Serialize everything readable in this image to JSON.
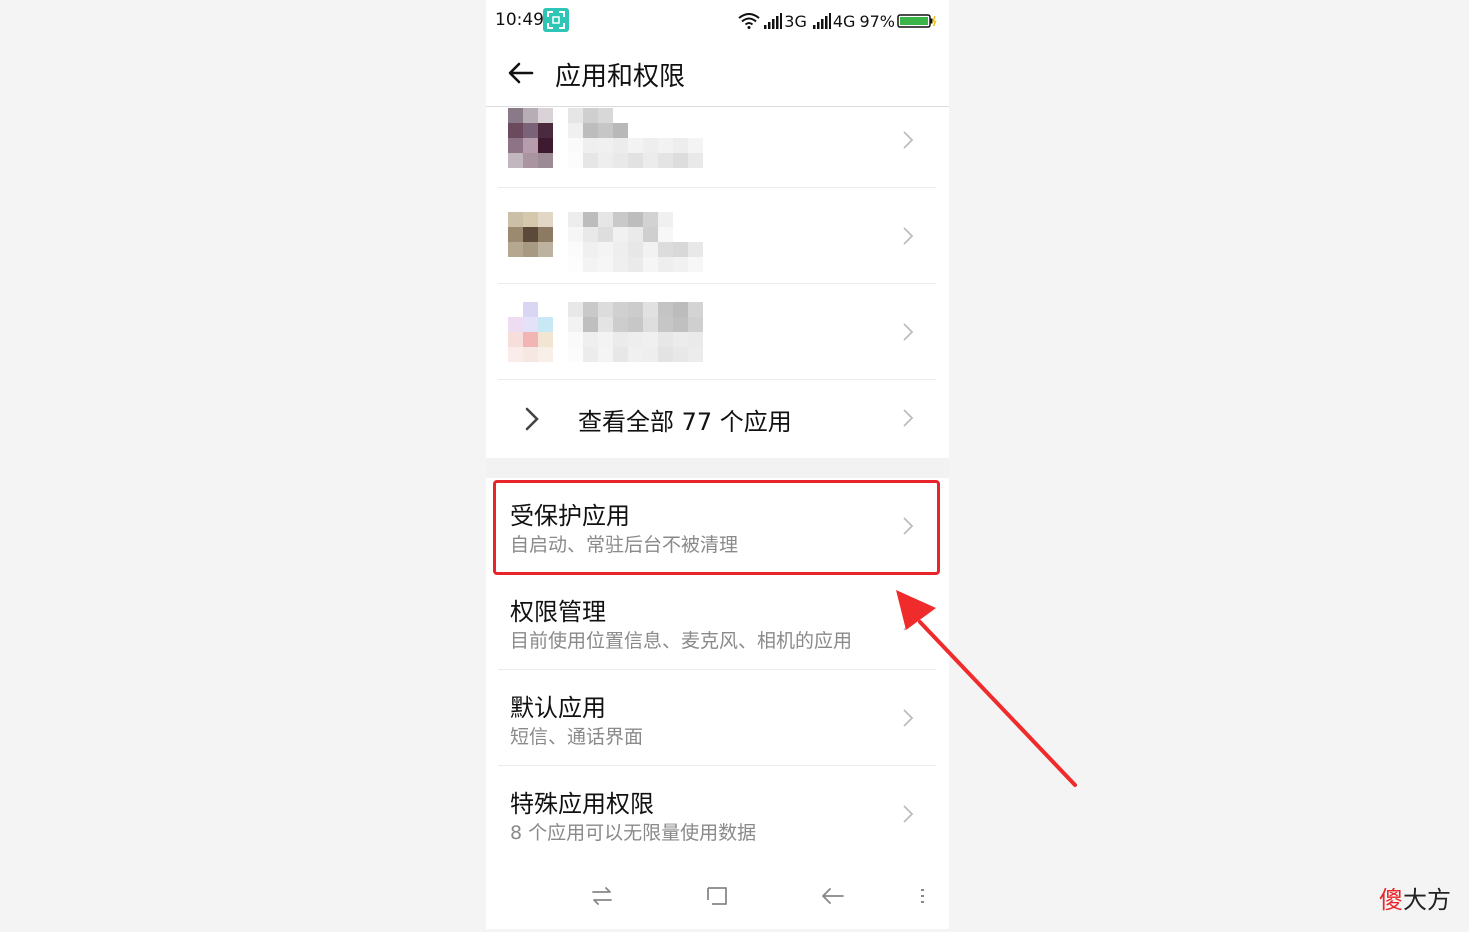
{
  "status_bar": {
    "time": "10:49",
    "network_1": "3G",
    "network_2": "4G",
    "battery": "97%"
  },
  "header": {
    "title": "应用和权限"
  },
  "apps": {
    "view_all_label": "查看全部 77 个应用"
  },
  "settings": [
    {
      "title": "受保护应用",
      "subtitle": "自启动、常驻后台不被清理"
    },
    {
      "title": "权限管理",
      "subtitle": "目前使用位置信息、麦克风、相机的应用"
    },
    {
      "title": "默认应用",
      "subtitle": "短信、通话界面"
    },
    {
      "title": "特殊应用权限",
      "subtitle": "8 个应用可以无限量使用数据"
    }
  ],
  "watermark": {
    "accent": "傻",
    "rest": "大方"
  },
  "colors": {
    "accent": "#2ec4b6",
    "highlight": "#e8252a"
  }
}
